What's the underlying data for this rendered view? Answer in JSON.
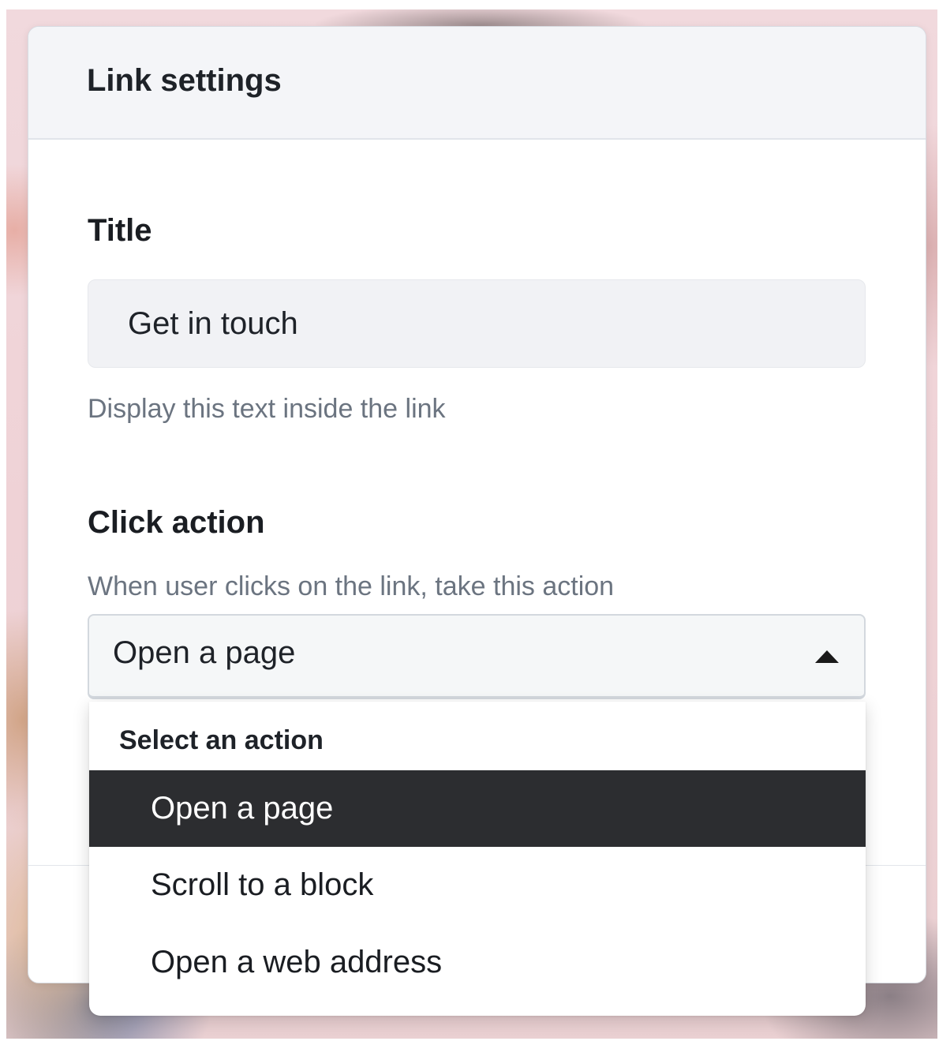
{
  "dialog": {
    "title": "Link settings"
  },
  "title_field": {
    "label": "Title",
    "value": "Get in touch",
    "help": "Display this text inside the link"
  },
  "click_action": {
    "label": "Click action",
    "help": "When user clicks on the link, take this action",
    "selected": "Open a page",
    "dropdown_heading": "Select an action",
    "options": [
      {
        "label": "Open a page",
        "highlighted": true
      },
      {
        "label": "Scroll to a block",
        "highlighted": false
      },
      {
        "label": "Open a web address",
        "highlighted": false
      }
    ],
    "icon": "caret-up-icon"
  },
  "colors": {
    "highlight_bg": "#2c2d30",
    "highlight_text": "#ffffff",
    "muted_text": "#6b7480",
    "header_bg": "#f4f5f8"
  }
}
